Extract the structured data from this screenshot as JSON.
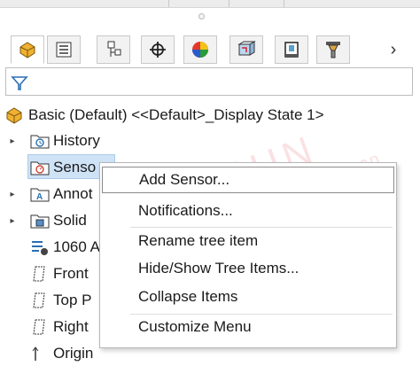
{
  "feature_manager": {
    "tabs": [
      {
        "icon": "feature-manager-tree-icon",
        "active": true
      },
      {
        "icon": "property-manager-icon",
        "active": false
      },
      {
        "icon": "configuration-manager-icon",
        "active": false
      },
      {
        "icon": "dimxpert-manager-icon",
        "active": false
      },
      {
        "icon": "display-manager-icon",
        "active": false
      },
      {
        "icon": "cam-feature-tree-icon",
        "active": false
      },
      {
        "icon": "cam-operation-tree-icon",
        "active": false
      },
      {
        "icon": "cam-tools-tree-icon",
        "active": false
      }
    ],
    "more_tabs_icon": "chevron-right-icon",
    "filter_icon": "filter-funnel-icon",
    "tree": {
      "root_label": "Basic (Default) <<Default>_Display State 1>",
      "items": [
        {
          "label": "History",
          "expandable": true
        },
        {
          "label": "Senso",
          "expandable": false,
          "selected": true
        },
        {
          "label": "Annot",
          "expandable": true
        },
        {
          "label": "Solid",
          "expandable": true
        },
        {
          "label": "1060 A",
          "expandable": false
        },
        {
          "label": "Front",
          "expandable": false
        },
        {
          "label": "Top P",
          "expandable": false
        },
        {
          "label": "Right",
          "expandable": false
        },
        {
          "label": "Origin",
          "expandable": false
        }
      ]
    }
  },
  "context_menu": {
    "items": [
      {
        "label": "Add Sensor..."
      },
      {
        "label": "Notifications..."
      },
      {
        "label": "Rename tree item"
      },
      {
        "label": "Hide/Show Tree Items..."
      },
      {
        "label": "Collapse Items"
      },
      {
        "label": "Customize Menu"
      }
    ]
  },
  "watermark": {
    "text_main": "JOYSUN",
    "text_sub": "www.joysunsoft.com.cn"
  },
  "colors": {
    "selection": "#cfe3f7",
    "part_icon": "#e8a020",
    "menu_border": "#b5b5b5"
  }
}
